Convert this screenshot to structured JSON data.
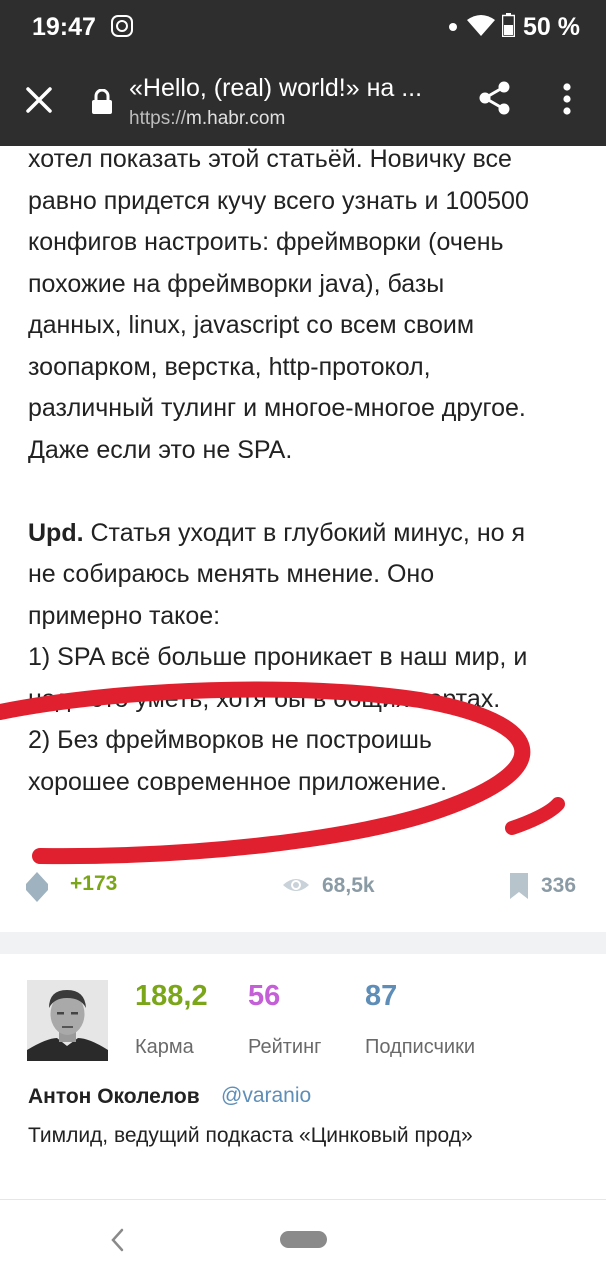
{
  "status_bar": {
    "time": "19:47",
    "battery": "50 %"
  },
  "url_bar": {
    "title": "«Hello, (real) world!» на ...",
    "url_scheme": "https://",
    "url_host": "m.habr.com"
  },
  "article": {
    "lines_1": [
      "хотел показать этой статьёй. Новичку все",
      "равно придется кучу всего узнать и 100500",
      "конфигов настроить: фреймворки (очень",
      "похожие на фреймворки java), базы",
      "данных, linux, javascript со всем своим",
      "зоопарком, верстка, http-протокол,",
      "различный тулинг и многое-многое другое.",
      "Даже если это не SPA."
    ],
    "upd_label": "Upd.",
    "upd_first_line": " Статья уходит в глубокий минус, но я",
    "lines_2": [
      "не собираюсь менять мнение. Оно",
      "примерно такое:",
      "1) SPA всё больше проникает в наш мир, и",
      "надо это уметь, хотя бы в общих чертах.",
      "2) Без фреймворков не построишь",
      "хорошее современное приложение."
    ]
  },
  "stats": {
    "score": "+173",
    "views": "68,5k",
    "bookmarks": "336"
  },
  "author": {
    "karma_value": "188,2",
    "karma_label": "Карма",
    "rating_value": "56",
    "rating_label": "Рейтинг",
    "subs_value": "87",
    "subs_label": "Подписчики",
    "name": "Антон Околелов",
    "nickname": "@varanio",
    "bio": "Тимлид, ведущий подкаста «Цинковый прод»"
  },
  "colors": {
    "bar_bg": "#2e2e2e",
    "score_green": "#7ba61a",
    "rating_purple": "#c45fd8",
    "link_blue": "#5e8eb8",
    "scribble_red": "#e0202e"
  }
}
